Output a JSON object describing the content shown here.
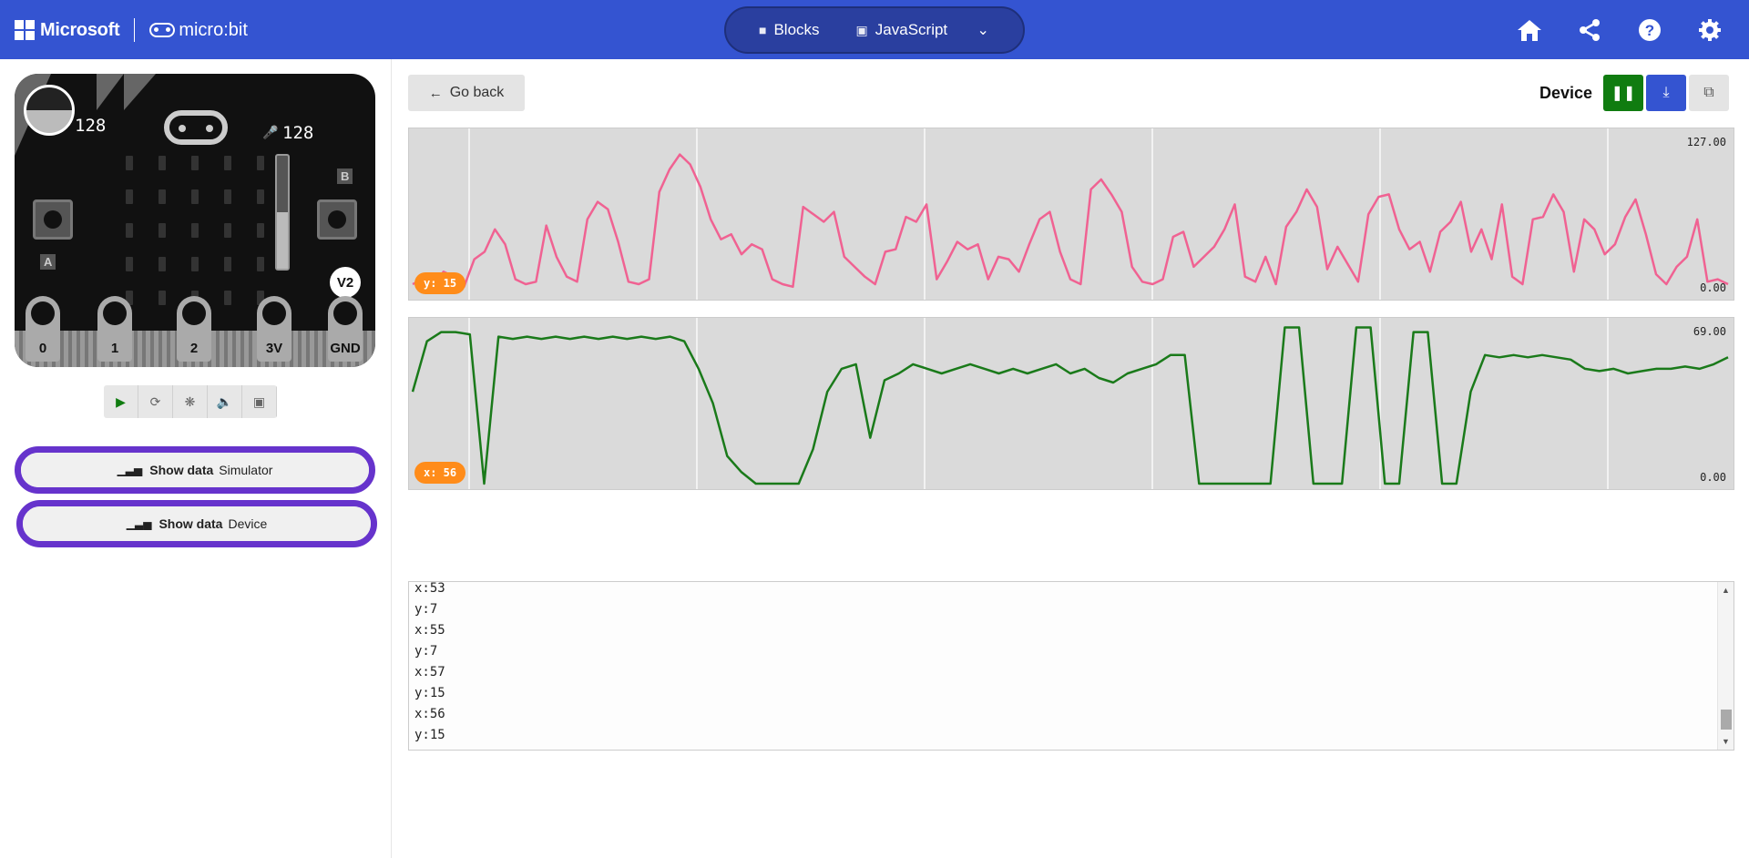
{
  "header": {
    "brand_ms": "Microsoft",
    "brand_mb": "micro:bit",
    "tab_blocks": "Blocks",
    "tab_js": "JavaScript",
    "bg_color": "#3454d1"
  },
  "simulator": {
    "light_level": "128",
    "sound_level": "128",
    "version": "V2",
    "button_a": "A",
    "button_b": "B",
    "pins": [
      "0",
      "1",
      "2",
      "3V",
      "GND"
    ]
  },
  "sidebar": {
    "show_data_sim": {
      "label": "Show data",
      "sub": "Simulator"
    },
    "show_data_dev": {
      "label": "Show data",
      "sub": "Device"
    }
  },
  "toolbar": {
    "go_back": "Go back",
    "device_label": "Device",
    "colors": {
      "pause": "#107c10",
      "download": "#3454d1",
      "copy": "#e4e4e4"
    }
  },
  "charts": [
    {
      "max_label": "127.00",
      "min_label": "0.00",
      "pill": "y: 15",
      "color": "#f06292"
    },
    {
      "max_label": "69.00",
      "min_label": "0.00",
      "pill": "x: 56",
      "color": "#1a7a1a"
    }
  ],
  "chart_data": [
    {
      "type": "line",
      "series": [
        {
          "name": "y",
          "values": [
            8,
            12,
            6,
            18,
            14,
            6,
            28,
            34,
            52,
            40,
            12,
            8,
            10,
            55,
            30,
            14,
            10,
            60,
            74,
            68,
            42,
            10,
            8,
            12,
            82,
            100,
            112,
            104,
            86,
            60,
            44,
            48,
            32,
            40,
            36,
            12,
            8,
            6,
            70,
            64,
            58,
            66,
            30,
            22,
            14,
            8,
            34,
            36,
            62,
            58,
            72,
            12,
            26,
            42,
            36,
            40,
            12,
            30,
            28,
            18,
            40,
            60,
            66,
            34,
            12,
            8,
            84,
            92,
            80,
            66,
            22,
            10,
            8,
            12,
            46,
            50,
            22,
            30,
            38,
            52,
            72,
            14,
            10,
            30,
            8,
            54,
            66,
            84,
            70,
            20,
            38,
            24,
            10,
            64,
            78,
            80,
            52,
            36,
            42,
            18,
            50,
            58,
            74,
            34,
            52,
            28,
            72,
            14,
            8,
            60,
            62,
            80,
            66,
            18,
            60,
            52,
            32,
            40,
            62,
            76,
            48,
            16,
            8,
            22,
            30,
            60,
            10,
            12,
            8
          ]
        }
      ],
      "ylim": [
        0,
        127
      ]
    },
    {
      "type": "line",
      "series": [
        {
          "name": "x",
          "values": [
            40,
            62,
            66,
            66,
            65,
            0,
            64,
            63,
            64,
            63,
            64,
            63,
            64,
            63,
            64,
            63,
            64,
            63,
            64,
            62,
            50,
            35,
            12,
            5,
            0,
            0,
            0,
            0,
            15,
            40,
            50,
            52,
            20,
            45,
            48,
            52,
            50,
            48,
            50,
            52,
            50,
            48,
            50,
            48,
            50,
            52,
            48,
            50,
            46,
            44,
            48,
            50,
            52,
            56,
            56,
            0,
            0,
            0,
            0,
            0,
            0,
            68,
            68,
            0,
            0,
            0,
            68,
            68,
            0,
            0,
            66,
            66,
            0,
            0,
            40,
            56,
            55,
            56,
            55,
            56,
            55,
            54,
            50,
            49,
            50,
            48,
            49,
            50,
            50,
            51,
            50,
            52,
            55
          ]
        }
      ],
      "ylim": [
        0,
        69
      ]
    }
  ],
  "console": {
    "lines": [
      "x:53",
      "y:7",
      "x:55",
      "y:7",
      "x:57",
      "y:15",
      "x:56",
      "y:15"
    ]
  }
}
